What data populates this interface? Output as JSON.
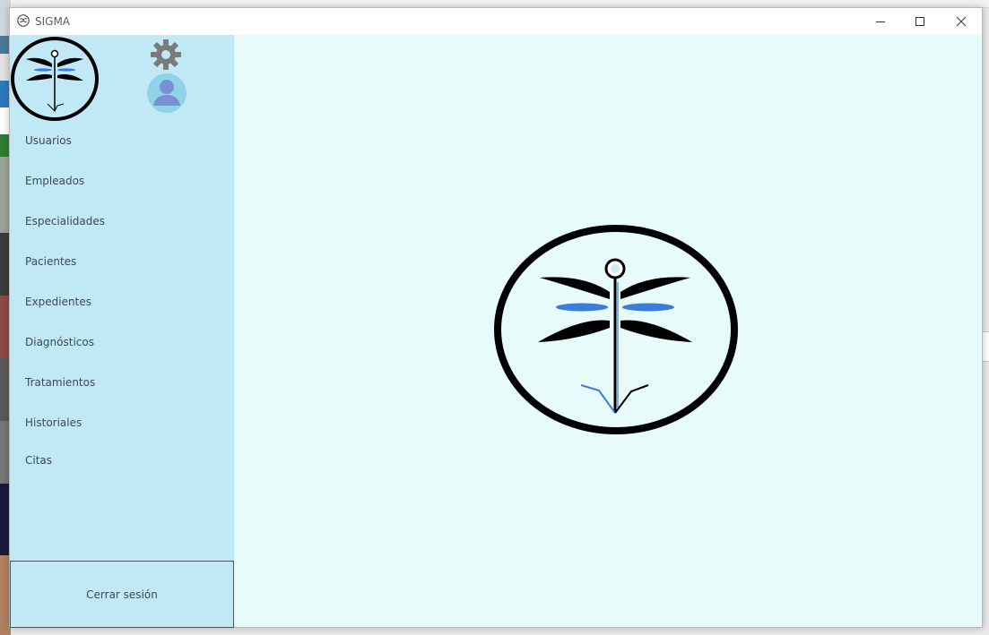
{
  "window": {
    "title": "SIGMA"
  },
  "sidebar": {
    "items": [
      {
        "label": "Usuarios"
      },
      {
        "label": "Empleados"
      },
      {
        "label": "Especialidades"
      },
      {
        "label": "Pacientes"
      },
      {
        "label": "Expedientes"
      },
      {
        "label": "Diagnósticos"
      },
      {
        "label": "Tratamientos"
      },
      {
        "label": "Historiales"
      },
      {
        "label": "Citas"
      }
    ],
    "logout_label": "Cerrar sesión",
    "icons": [
      "dragonfly-logo",
      "gear-icon",
      "user-avatar-icon"
    ]
  },
  "colors": {
    "sidebar_bg": "#c0e8f5",
    "main_bg": "#e8fbfb",
    "wing_accent": "#3b7ddd",
    "settings_gray": "#7a7a7a",
    "avatar_bg": "#8fd3e6",
    "avatar_fg": "#7b8fd6"
  }
}
